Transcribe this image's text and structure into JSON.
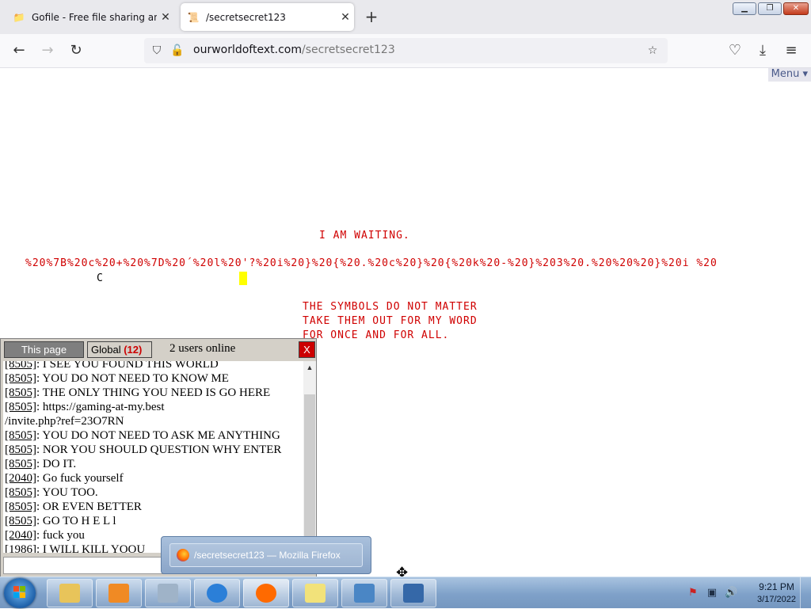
{
  "browser": {
    "tabs": [
      {
        "title": "Gofile - Free file sharing and sto",
        "icon": "folder-icon",
        "active": false
      },
      {
        "title": "/secretsecret123",
        "icon": "scroll-icon",
        "active": true
      }
    ],
    "url_host": "ourworldoftext.com",
    "url_path": "/secretsecret123"
  },
  "page": {
    "menu_label": "Menu",
    "menu_arrow": "▾",
    "waiting_text": "I AM WAITING.",
    "encoded_text": "%20%7B%20c%20+%20%7D%20´%20l%20'?%20i%20}%20{%20.%20c%20}%20{%20k%20-%20}%203%20.%20%20%20}%20i %20",
    "stray_char": "C",
    "lines": [
      "THE SYMBOLS DO NOT MATTER",
      "TAKE THEM OUT FOR MY WORD",
      "FOR ONCE AND FOR ALL."
    ],
    "text_color": "#d00000"
  },
  "chat": {
    "tab_page": "This page",
    "tab_global": "Global",
    "global_count": "(12)",
    "users_online": "2 users online",
    "close_label": "X",
    "messages": [
      {
        "id": "[8505]",
        "text": "I SEE YOU FOUND THIS WORLD"
      },
      {
        "id": "[8505]",
        "text": "YOU DO NOT NEED TO KNOW ME"
      },
      {
        "id": "[8505]",
        "text": "THE ONLY THING YOU NEED IS GO HERE"
      },
      {
        "id": "[8505]",
        "text": "https://gaming-at-my.best"
      },
      {
        "id": "",
        "text": "/invite.php?ref=23O7RN"
      },
      {
        "id": "[8505]",
        "text": "YOU DO NOT NEED TO ASK ME ANYTHING"
      },
      {
        "id": "[8505]",
        "text": "NOR YOU SHOULD QUESTION WHY ENTER"
      },
      {
        "id": "[8505]",
        "text": "DO IT."
      },
      {
        "id": "[2040]",
        "text": "Go fuck yourself"
      },
      {
        "id": "[8505]",
        "text": "YOU TOO."
      },
      {
        "id": "[8505]",
        "text": "OR EVEN BETTER"
      },
      {
        "id": "[8505]",
        "text": "GO TO H E L l"
      },
      {
        "id": "[2040]",
        "text": "fuck you"
      },
      {
        "id": "[1986]",
        "text": "I WILL KILL YOOU"
      }
    ]
  },
  "taskbar": {
    "preview_title": "/secretsecret123 — Mozilla Firefox",
    "clock_time": "9:21 PM",
    "clock_date": "3/17/2022",
    "pinned": [
      {
        "name": "explorer-icon",
        "color": "#e8c45a"
      },
      {
        "name": "media-player-icon",
        "color": "#f08a24"
      },
      {
        "name": "tools-icon",
        "color": "#9fb3c8"
      },
      {
        "name": "ie-icon",
        "color": "#2b7fd8"
      },
      {
        "name": "firefox-icon",
        "color": "#ff6a00"
      },
      {
        "name": "notes-icon",
        "color": "#f2e27a"
      },
      {
        "name": "control-panel-icon",
        "color": "#4a86c5"
      },
      {
        "name": "window-icon",
        "color": "#3568a8"
      }
    ]
  }
}
